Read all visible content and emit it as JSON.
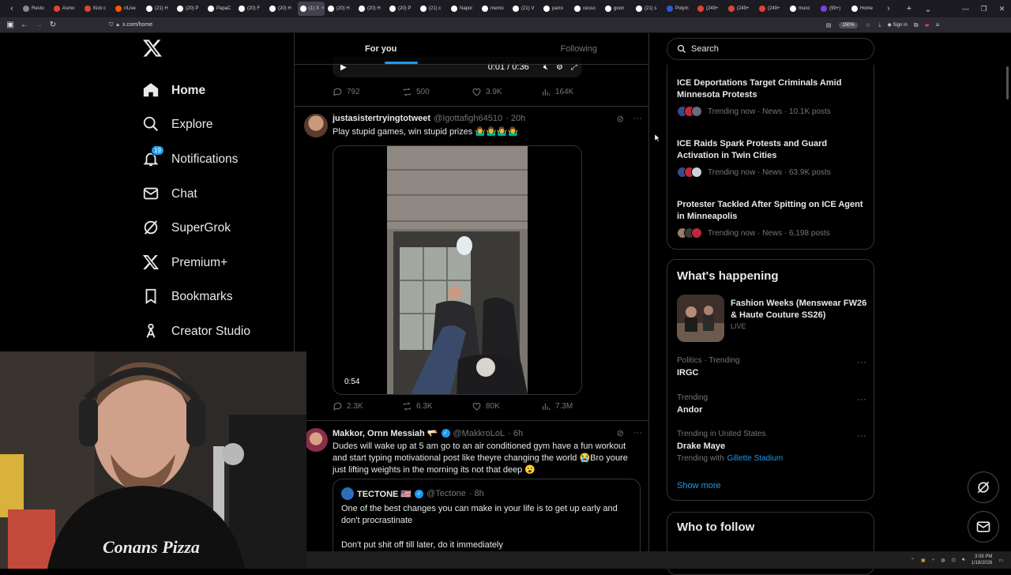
{
  "browser": {
    "tabs": [
      {
        "label": "Resto",
        "color": "#888"
      },
      {
        "label": "Asmo",
        "color": "#e0423a"
      },
      {
        "label": "Kick c",
        "color": "#e0423a"
      },
      {
        "label": "r/Live",
        "color": "#ff5700"
      },
      {
        "label": "(21) H",
        "color": "#fff"
      },
      {
        "label": "(20) P",
        "color": "#fff"
      },
      {
        "label": "PapaC",
        "color": "#fff"
      },
      {
        "label": "(20) F",
        "color": "#fff"
      },
      {
        "label": "(20) H",
        "color": "#fff"
      },
      {
        "label": "(1) X",
        "color": "#fff",
        "active": true
      },
      {
        "label": "(20) H",
        "color": "#fff"
      },
      {
        "label": "(20) H",
        "color": "#fff"
      },
      {
        "label": "(20) P",
        "color": "#fff"
      },
      {
        "label": "(21) c",
        "color": "#fff"
      },
      {
        "label": "Napol",
        "color": "#fff"
      },
      {
        "label": "memo",
        "color": "#fff"
      },
      {
        "label": "(21) V",
        "color": "#fff"
      },
      {
        "label": "parro",
        "color": "#fff"
      },
      {
        "label": "cesso",
        "color": "#fff"
      },
      {
        "label": "goon",
        "color": "#fff"
      },
      {
        "label": "(21) s",
        "color": "#fff"
      },
      {
        "label": "Polym",
        "color": "#2a5bd7"
      },
      {
        "label": "(249+",
        "color": "#e0423a"
      },
      {
        "label": "(249+",
        "color": "#e0423a"
      },
      {
        "label": "(249+",
        "color": "#e0423a"
      },
      {
        "label": "munc",
        "color": "#fff"
      },
      {
        "label": "(99+)",
        "color": "#7b3fe4"
      },
      {
        "label": "Home",
        "color": "#fff"
      }
    ],
    "url": "x.com/home",
    "zoom": "150%",
    "signin": "Sign in"
  },
  "nav": {
    "items": [
      {
        "label": "Home",
        "icon": "home-icon",
        "bold": true
      },
      {
        "label": "Explore",
        "icon": "search-icon"
      },
      {
        "label": "Notifications",
        "icon": "bell-icon",
        "badge": "19"
      },
      {
        "label": "Chat",
        "icon": "mail-icon"
      },
      {
        "label": "SuperGrok",
        "icon": "grok-icon"
      },
      {
        "label": "Premium+",
        "icon": "x-icon"
      },
      {
        "label": "Bookmarks",
        "icon": "bookmark-icon"
      },
      {
        "label": "Creator Studio",
        "icon": "creator-icon"
      }
    ]
  },
  "feed": {
    "tabs": [
      "For you",
      "Following"
    ],
    "top_video": {
      "time": "0:01 / 0:36"
    },
    "top_actions": {
      "replies": "792",
      "reposts": "500",
      "likes": "3.9K",
      "views": "164K"
    },
    "tweet1": {
      "name": "justasistertryingtotweet",
      "handle": "@Igottafigh64510",
      "time": "· 20h",
      "text": "Play stupid games, win stupid prizes 🤷‍♂️🤷‍♂️🤷‍♂️🤷‍♂️",
      "duration": "0:54",
      "replies": "2.3K",
      "reposts": "6.3K",
      "likes": "80K",
      "views": "7.3M"
    },
    "tweet2": {
      "name": "Makkor, Ornn Messiah 🫳🏻",
      "handle": "@MakkroLoL",
      "time": "· 6h",
      "text": "Dudes will wake up at 5 am go to an air conditioned gym have a fun workout and start typing motivational post like theyre changing the world 😭Bro youre just lifting weights in the morning its not that deep 😮",
      "quote": {
        "name": "TECTONE 🇺🇸",
        "handle": "@Tectone",
        "time": "· 8h",
        "text": "One of the best changes you can make in your life is to get up early and don't procrastinate",
        "text2": "Don't put shit off till later, do it immediately"
      }
    }
  },
  "sidebar": {
    "search_placeholder": "Search",
    "news": [
      {
        "title": "ICE Deportations Target Criminals Amid Minnesota Protests",
        "meta": "Trending now · News · 10.1K posts"
      },
      {
        "title": "ICE Raids Spark Protests and Guard Activation in Twin Cities",
        "meta": "Trending now · News · 63.9K posts"
      },
      {
        "title": "Protester Tackled After Spitting on ICE Agent in Minneapolis",
        "meta": "Trending now · News · 6,198 posts"
      }
    ],
    "happening": {
      "title": "What's happening",
      "event_title": "Fashion Weeks (Menswear FW26 & Haute Couture SS26)",
      "event_status": "LIVE",
      "trends": [
        {
          "context": "Politics · Trending",
          "name": "IRGC"
        },
        {
          "context": "Trending",
          "name": "Andor"
        },
        {
          "context": "Trending in United States",
          "name": "Drake Maye",
          "with_label": "Trending with",
          "with": "Gillette Stadium"
        }
      ],
      "show_more": "Show more"
    },
    "who_to_follow": "Who to follow"
  },
  "taskbar": {
    "time": "3:09 PM",
    "date": "1/18/2026"
  }
}
